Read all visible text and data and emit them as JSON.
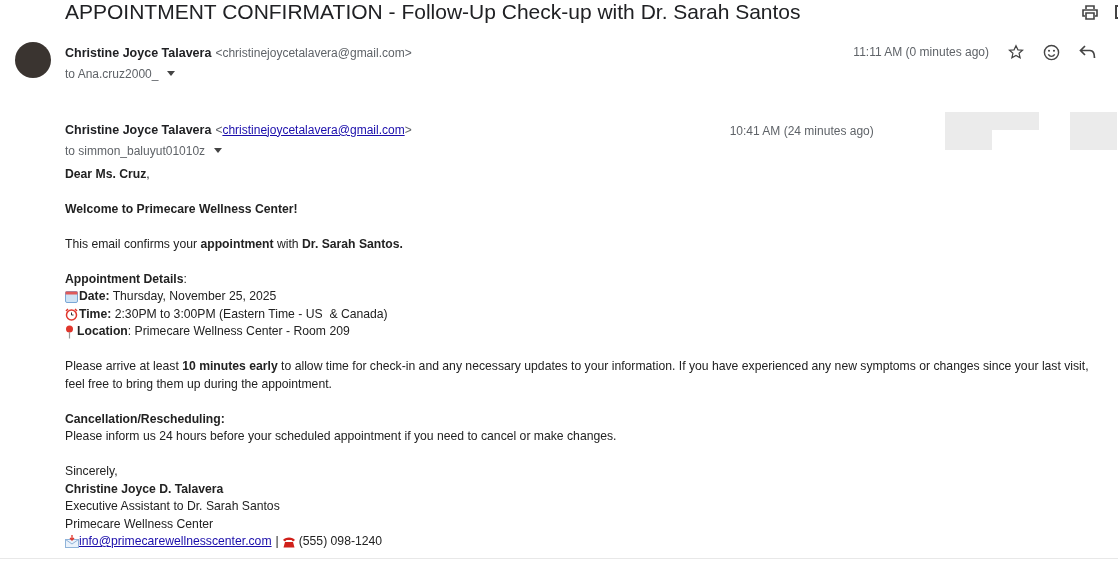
{
  "subject": "APPOINTMENT CONFIRMATION - Follow-Up Check-up with Dr. Sarah Santos",
  "message": {
    "sender_name": "Christine Joyce Talavera",
    "sender_email": "<christinejoycetalavera@gmail.com>",
    "recipient": "to Ana.cruz2000_",
    "time": "11:11 AM (0 minutes ago)"
  },
  "quoted": {
    "sender_name": "Christine Joyce Talavera",
    "email_open": "<",
    "sender_email": "christinejoycetalavera@gmail.com",
    "email_close": ">",
    "recipient": "to simmon_baluyut01010z",
    "time": "10:41 AM (24 minutes ago)",
    "paragraphs": [
      [
        {
          "kind": "text",
          "text": "**Dear Ms. Cruz**,"
        }
      ],
      [
        {
          "kind": "strong",
          "text": "Welcome to Primecare Wellness Center!"
        }
      ],
      [
        {
          "kind": "text",
          "text": "This email confirms your **appointment** with **Dr. Sarah Santos.**"
        }
      ],
      [
        {
          "kind": "text",
          "text": "**Appointment Details**:"
        },
        {
          "kind": "calendar_item",
          "text": "**Date:** Thursday, November 25, 2025"
        },
        {
          "kind": "clock_item",
          "text": "**Time:** 2:30PM to 3:00PM (Eastern Time - US  & Canada)"
        },
        {
          "kind": "pin_item",
          "text": "**Location**: Primecare Wellness Center - Room 209"
        }
      ],
      [
        {
          "kind": "text",
          "text": "Please arrive at least **10 minutes early** to allow time for check-in and any necessary updates to your information. If you have experienced any new symptoms or changes since your last visit, feel free to bring them up during the appointment."
        }
      ],
      [
        {
          "kind": "strong",
          "text": "Cancellation/Rescheduling:"
        },
        {
          "kind": "text",
          "text": "Please inform us 24 hours before your scheduled appointment if you need to cancel or make changes."
        }
      ],
      [
        {
          "kind": "text",
          "text": "Sincerely,"
        },
        {
          "kind": "strong",
          "text": "Christine Joyce D. Talavera"
        },
        {
          "kind": "text",
          "text": "Executive Assistant to Dr. Sarah Santos"
        },
        {
          "kind": "text",
          "text": "Primecare Wellness Center"
        },
        {
          "kind": "contact",
          "email": "info@primecarewellnesscenter.com",
          "separator": "|",
          "phone": "(555) 098-1240"
        }
      ]
    ]
  }
}
